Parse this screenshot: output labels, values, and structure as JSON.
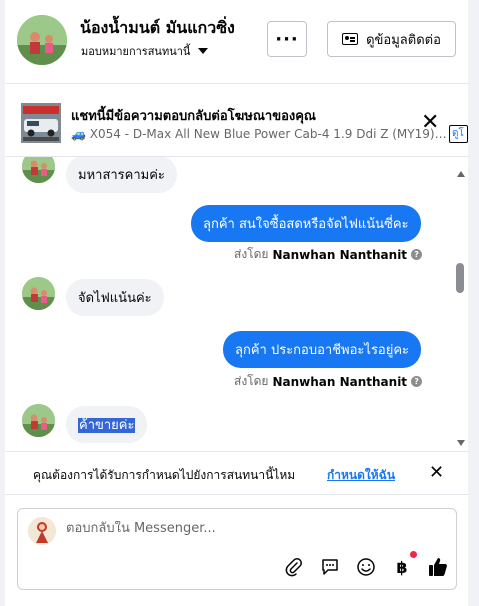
{
  "header": {
    "name": "น้องน้ำมนต์ มันแกวซิ่ง",
    "assign_label": "มอบหมายการสนทนานี้",
    "more_label": "···",
    "contact_button": "ดูข้อมูลติดต่อ"
  },
  "ad_banner": {
    "title": "แชทนี้มีข้อความตอบกลับต่อโฆษณาของคุณ",
    "subtitle": "🚙 X054 - D-Max All New Blue Power Cab-4 1.9 Ddi Z (MY19) MT*…",
    "peek_text": "ดูโ"
  },
  "messages": [
    {
      "direction": "in",
      "text": "มหาสารคามค่ะ"
    },
    {
      "direction": "out",
      "text": "ลุกค้า สนใจซื้อสดหรือจัดไฟแน้นซี่คะ",
      "sent_by_prefix": "ส่งโดย",
      "sent_by_name": "Nanwhan Nanthanit"
    },
    {
      "direction": "in",
      "text": "จัดไฟแน้นค่ะ"
    },
    {
      "direction": "out",
      "text": "ลุกค้า ประกอบอาชีพอะไรอยู่คะ",
      "sent_by_prefix": "ส่งโดย",
      "sent_by_name": "Nanwhan Nanthanit"
    },
    {
      "direction": "in",
      "text": "ค้าขายค่ะ"
    }
  ],
  "prompt": {
    "text": "คุณต้องการได้รับการกำหนดไปยังการสนทนานี้ไหม",
    "link": "กำหนดให้ฉัน"
  },
  "composer": {
    "placeholder": "ตอบกลับใน Messenger..."
  },
  "toolbar_icons": [
    "paperclip-icon",
    "saved-reply-icon",
    "emoji-icon",
    "baht-payment-icon",
    "thumbs-up-icon"
  ],
  "colors": {
    "accent": "#1877f2",
    "incoming_bubble": "#f0f2f5",
    "notification_dot": "#f02849"
  }
}
